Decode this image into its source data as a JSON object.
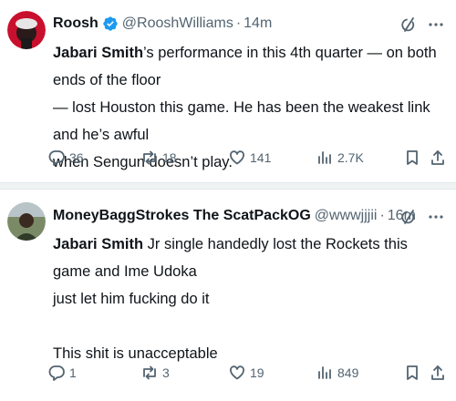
{
  "tweets": [
    {
      "name": "Roosh",
      "handle": "@RooshWilliams",
      "separator": "·",
      "time": "14m",
      "text_bold": "Jabari Smith",
      "text_rest_lines": [
        "’s performance in this 4th quarter — on both ends of the floor",
        "— lost Houston this game. He has been the weakest link and he’s awful",
        "when Sengun doesn’t play."
      ],
      "stats": {
        "replies": "36",
        "retweets": "18",
        "likes": "141",
        "views": "2.7K"
      },
      "icons": {
        "verified": "verified-badge-icon",
        "grok": "grok-icon",
        "more": "more-icon"
      },
      "colors": {
        "verified": "#1d9bf0",
        "avatar_bg": "#c8102e"
      }
    },
    {
      "name": "MoneyBaggStrokes The ScatPackOG",
      "handle": "@wwwjjjii",
      "separator": "·",
      "time": "16m",
      "text_bold": "Jabari Smith",
      "text_lines": [
        " Jr single handedly lost the Rockets this game and Ime Udoka",
        "just let him fucking do it",
        "",
        "This shit is unacceptable"
      ],
      "stats": {
        "replies": "1",
        "retweets": "3",
        "likes": "19",
        "views": "849"
      },
      "icons": {
        "grok": "grok-icon",
        "more": "more-icon"
      },
      "colors": {
        "avatar_bg": "#5a6b4a"
      }
    }
  ]
}
